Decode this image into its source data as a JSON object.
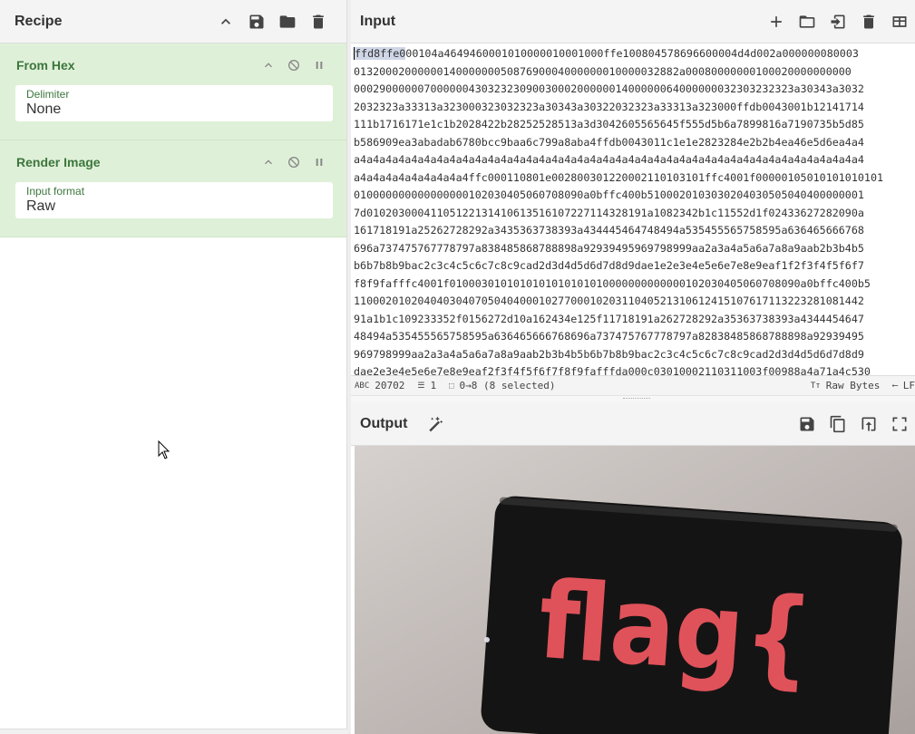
{
  "recipe": {
    "title": "Recipe",
    "operations": [
      {
        "name": "From Hex",
        "field_label": "Delimiter",
        "field_value": "None"
      },
      {
        "name": "Render Image",
        "field_label": "Input format",
        "field_value": "Raw"
      }
    ]
  },
  "input": {
    "title": "Input",
    "selected_text": "ffd8ffe0",
    "lines": [
      "00104a4649460001010000010001000ffe100804578696600004d4d002a000000080003",
      "013200020000001400000005087690004000000010000032882a00080000000100020000000000",
      "000290000007000000430323230900300020000001400000064000000032303232323a30343a3032",
      "2032323a33313a323000323032323a30343a30322032323a33313a323000ffdb0043001b12141714",
      "111b1716171e1c1b2028422b28252528513a3d3042605565645f555d5b6a7899816a7190735b5d85",
      "b586909ea3abadab6780bcc9baa6c799a8aba4ffdb0043011c1e1e2823284e2b2b4ea46e5d6ea4a4",
      "a4a4a4a4a4a4a4a4a4a4a4a4a4a4a4a4a4a4a4a4a4a4a4a4a4a4a4a4a4a4a4a4a4a4a4a4a4a4a4a4",
      "a4a4a4a4a4a4a4a4a4ffc000110801e002800301220002110103101ffc4001f00000105010101010101",
      "010000000000000000102030405060708090a0bffc400b5100020103030204030505040400000001",
      "7d01020300041105122131410613516107227114328191a1082342b1c11552d1f02433627282090a",
      "161718191a25262728292a3435363738393a434445464748494a535455565758595a636465666768",
      "696a737475767778797a838485868788898a92939495969798999aa2a3a4a5a6a7a8a9aab2b3b4b5",
      "b6b7b8b9bac2c3c4c5c6c7c8c9cad2d3d4d5d6d7d8d9dae1e2e3e4e5e6e7e8e9eaf1f2f3f4f5f6f7",
      "f8f9fafffc4001f0100030101010101010101010000000000000102030405060708090a0bffc400b5",
      "11000201020404030407050404000102770001020311040521310612415107617113223281081442",
      "91a1b1c109233352f0156272d10a162434e125f11718191a262728292a35363738393a4344454647",
      "48494a535455565758595a636465666768696a737475767778797a82838485868788898a92939495",
      "969798999aa2a3a4a5a6a7a8a9aab2b3b4b5b6b7b8b9bac2c3c4c5c6c7c8c9cad2d3d4d5d6d7d8d9",
      "dae2e3e4e5e6e7e8e9eaf2f3f4f5f6f7f8f9fafffda000c03010002110311003f00988a4a71a4c530"
    ],
    "status": {
      "length": "20702",
      "lines": "1",
      "selection": "0→8 (8 selected)",
      "encoding": "Raw Bytes",
      "eol": "LF"
    }
  },
  "output": {
    "title": "Output",
    "image_text": "flag{"
  }
}
